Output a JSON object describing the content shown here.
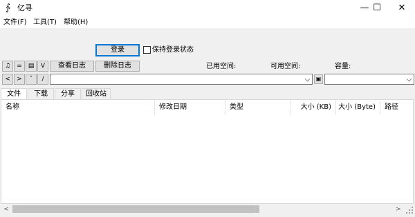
{
  "window": {
    "title": "亿寻",
    "controls": {
      "minimize": "—",
      "maximize": "☐",
      "close": "✕"
    }
  },
  "menu": [
    "文件(F)",
    "工具(T)",
    "帮助(H)"
  ],
  "login": {
    "button_label": "登录",
    "remember_label": "保持登录状态",
    "remember_checked": false
  },
  "toolbar": {
    "icon_buttons": [
      {
        "icon": "bell-icon",
        "glyph": "♫"
      },
      {
        "icon": "equals-icon",
        "glyph": "="
      },
      {
        "icon": "calendar-icon",
        "glyph": "▤"
      },
      {
        "icon": "check-icon",
        "glyph": "V"
      }
    ],
    "view_log_label": "查看日志",
    "delete_log_label": "删除日志",
    "used_space_label": "已用空间:",
    "free_space_label": "可用空间:",
    "capacity_label": "容量:"
  },
  "nav": {
    "back": "<",
    "forward": ">",
    "up": "ˆ",
    "root": "/",
    "path_value": "",
    "drive_value": ""
  },
  "tabs": [
    {
      "label": "文件",
      "active": true
    },
    {
      "label": "下载",
      "active": false
    },
    {
      "label": "分享",
      "active": false
    },
    {
      "label": "回收站",
      "active": false
    }
  ],
  "table": {
    "columns": [
      "名称",
      "修改日期",
      "类型",
      "大小 (KB)",
      "大小 (Byte)",
      "路径"
    ],
    "rows": []
  },
  "scrollbar": {
    "left": "<",
    "right": ">"
  }
}
